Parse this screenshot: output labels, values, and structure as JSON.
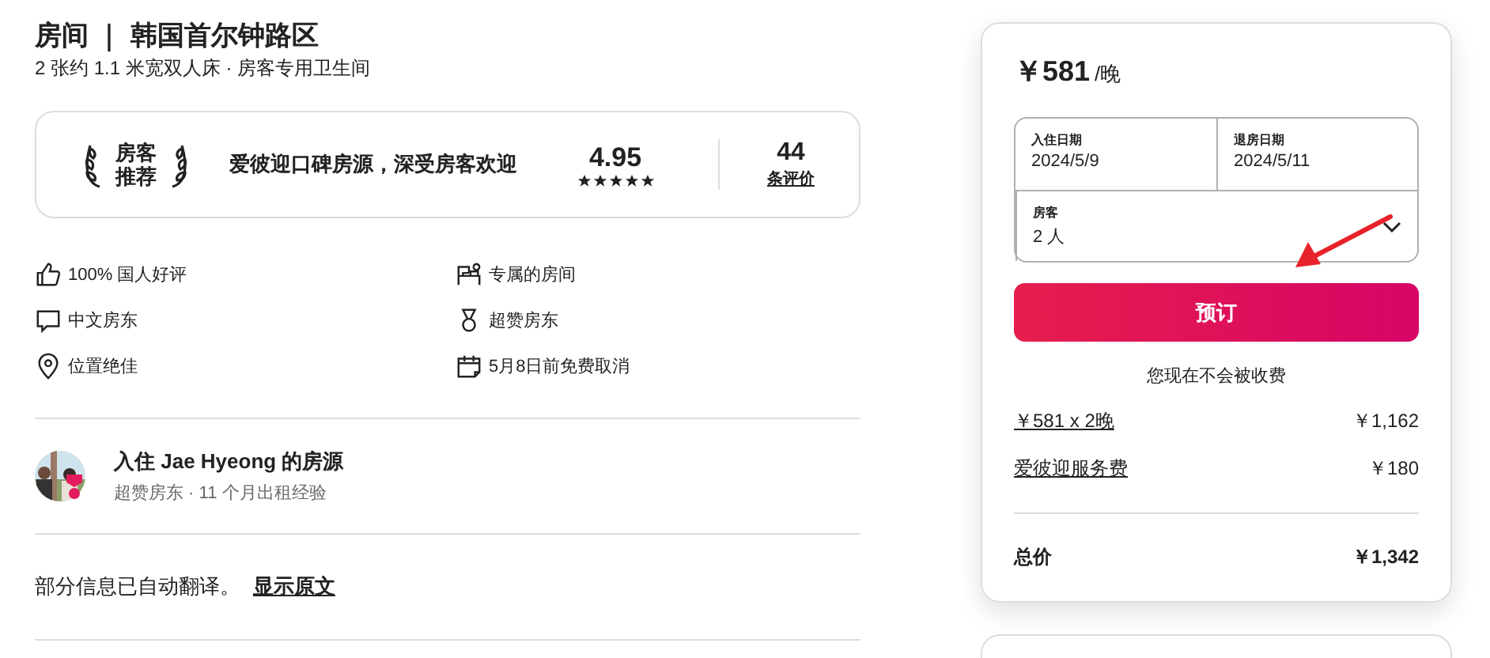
{
  "listing": {
    "title": "房间 ｜ 韩国首尔钟路区",
    "subtitle": "2 张约 1.1 米宽双人床 · 房客专用卫生间"
  },
  "highlight": {
    "badge_top": "房客",
    "badge_bottom": "推荐",
    "tagline": "爱彼迎口碑房源，深受房客欢迎",
    "rating": "4.95",
    "stars": 5,
    "reviews_count": "44",
    "reviews_label": "条评价"
  },
  "features": [
    {
      "kind": "thumb",
      "label": "100% 国人好评"
    },
    {
      "kind": "room",
      "label": "专属的房间"
    },
    {
      "kind": "chat",
      "label": "中文房东"
    },
    {
      "kind": "medal",
      "label": "超赞房东"
    },
    {
      "kind": "pin",
      "label": "位置绝佳"
    },
    {
      "kind": "calendar",
      "label": "5月8日前免费取消"
    }
  ],
  "host": {
    "title": "入住 Jae Hyeong 的房源",
    "detail": "超赞房东 · 11 个月出租经验",
    "superhost": true
  },
  "translation": {
    "text": "部分信息已自动翻译。",
    "link": "显示原文"
  },
  "booking": {
    "price": "￥581",
    "per": "/晚",
    "checkin": {
      "label": "入住日期",
      "value": "2024/5/9"
    },
    "checkout": {
      "label": "退房日期",
      "value": "2024/5/11"
    },
    "guests": {
      "label": "房客",
      "value": "2 人"
    },
    "button": "预订",
    "note": "您现在不会被收费",
    "lines": [
      {
        "label": "￥581 x 2晚",
        "amount": "￥1,162"
      },
      {
        "label": "爱彼迎服务费",
        "amount": "￥180"
      }
    ],
    "total": {
      "label": "总价",
      "amount": "￥1,342"
    }
  }
}
